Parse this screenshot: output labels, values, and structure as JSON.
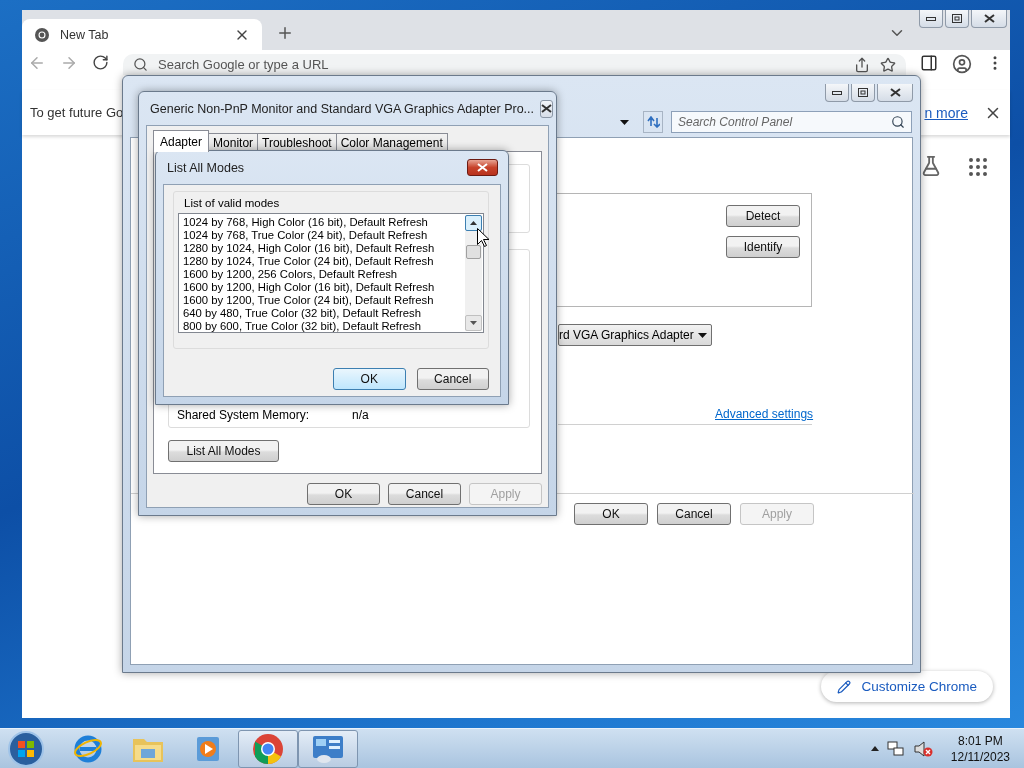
{
  "browser": {
    "tab": {
      "title": "New Tab"
    },
    "omnibox": {
      "placeholder": "Search Google or type a URL"
    },
    "infobar": {
      "message": "To get future Go",
      "link": "n more"
    },
    "customize_button": "Customize Chrome"
  },
  "control_panel": {
    "search": {
      "placeholder": "Search Control Panel"
    },
    "adapter_dropdown": "rd VGA Graphics Adapter",
    "buttons": [
      {
        "label": "Detect"
      },
      {
        "label": "Identify"
      }
    ],
    "advanced_link": "Advanced settings",
    "footer_buttons": [
      {
        "label": "OK",
        "disabled": false
      },
      {
        "label": "Cancel",
        "disabled": false
      },
      {
        "label": "Apply",
        "disabled": true
      }
    ]
  },
  "properties_dialog": {
    "title": "Generic Non-PnP Monitor and Standard VGA Graphics Adapter Pro...",
    "tabs": [
      {
        "label": "Adapter",
        "selected": true
      },
      {
        "label": "Monitor",
        "selected": false
      },
      {
        "label": "Troubleshoot",
        "selected": false
      },
      {
        "label": "Color Management",
        "selected": false
      }
    ],
    "shared_memory": {
      "label": "Shared System Memory:",
      "value": "n/a"
    },
    "list_modes_button": "List All Modes",
    "footer_buttons": [
      {
        "label": "OK",
        "disabled": false
      },
      {
        "label": "Cancel",
        "disabled": false
      },
      {
        "label": "Apply",
        "disabled": true
      }
    ]
  },
  "modes_dialog": {
    "title": "List All Modes",
    "group_label": "List of valid modes",
    "modes": [
      "1024 by 768, High Color (16 bit), Default Refresh",
      "1024 by 768, True Color (24 bit), Default Refresh",
      "1280 by 1024, High Color (16 bit), Default Refresh",
      "1280 by 1024, True Color (24 bit), Default Refresh",
      "1600 by 1200, 256 Colors, Default Refresh",
      "1600 by 1200, High Color (16 bit), Default Refresh",
      "1600 by 1200, True Color (24 bit), Default Refresh",
      "640 by 480, True Color (32 bit), Default Refresh",
      "800 by 600, True Color (32 bit), Default Refresh"
    ],
    "buttons": [
      {
        "label": "OK",
        "default": true
      },
      {
        "label": "Cancel",
        "default": false
      }
    ]
  },
  "taskbar": {
    "apps": [
      {
        "kind": "ie",
        "active": false
      },
      {
        "kind": "explorer",
        "active": false
      },
      {
        "kind": "media",
        "active": false
      },
      {
        "kind": "chrome",
        "active": true
      },
      {
        "kind": "control",
        "active": true
      }
    ],
    "clock": {
      "time": "8:01 PM",
      "date": "12/11/2023"
    }
  }
}
